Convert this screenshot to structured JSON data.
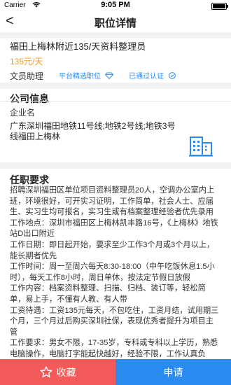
{
  "status_bar": {
    "carrier": "Carrier",
    "time": "9:05 PM"
  },
  "nav": {
    "back_glyph": "<",
    "title": "职位详情"
  },
  "job": {
    "title": "福田上梅林附近135/天资料整理员",
    "salary": "135元/天",
    "type": "文员助理",
    "tags": [
      {
        "label": "平台精选职位",
        "icon": "diamond-icon"
      },
      {
        "label": "已通过认证",
        "icon": "verified-check-icon"
      }
    ]
  },
  "company": {
    "section_title": "公司信息",
    "label": "企业名",
    "address": "广东深圳福田地铁11号线;地铁2号线;地铁3号线福田上梅林",
    "icon": "building-icon"
  },
  "requirements": {
    "section_title": "任职要求",
    "text": "招聘深圳福田区单位项目资料整理员20人，空调办公室内上班，环境很好，可开实习证明，工作简单，社会人士、应届生、实习生均可报名，实习生或有档案整理经验者优先录用\n工作地点：深圳市福田区上梅林凯丰路16号，《上梅林》地铁站D出口附近\n工作日期：即日起开始，要求至少工作3个月或3个月以上，能长期者优先\n工作时间：周一至周六每天8:30-18:00（中午吃饭休息1.5小时），每天工作8小时，周日单休，按法定节假日放假\n工作内容：档案资料整理、扫描、归档、装订等，轻松简单，易上手，不懂有人教、有人带\n工资待遇：工资135元每天，不包吃住，工资月结，试用期三个月，三个月过后购买深圳社保，表现优秀者提升为项目主管\n工作要求：男女不限，17-35岁，专科或专科以上学历，熟悉电脑操作，电脑打字能起快越好，经验不限，工作认真负责，做事踏实认真，有无经验均可，有档案整理经验者优先报名发《姓名+电话+户籍哪里人+年龄+学历+凯丰路资料员"
  },
  "bottom": {
    "favorite_label": "收藏",
    "apply_label": "申请"
  },
  "colors": {
    "accent": "#2a8cf0",
    "salary": "#f0a020",
    "favorite": "#f35b5b"
  }
}
